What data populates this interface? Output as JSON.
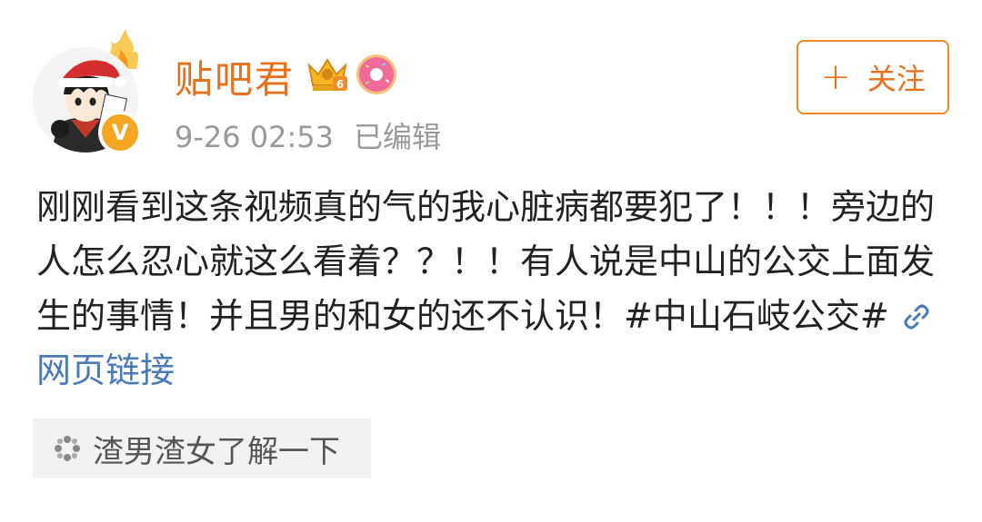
{
  "post": {
    "author": {
      "name": "贴吧君",
      "avatar_icon": "santa-hat-anime-avatar",
      "verified_icon": "verified-v-badge",
      "verified_label": "V",
      "badges": [
        "crown-vip-icon",
        "donut-icon"
      ],
      "crown_level": "6"
    },
    "timestamp": "9-26 02:53",
    "edited_label": "已编辑",
    "follow_button": {
      "plus": "+",
      "label": "关注"
    },
    "text": "刚刚看到这条视频真的气的我心脏病都要犯了！！！旁边的人怎么忍心就这么看着？？！！有人说是中山的公交上面发生的事情！并且男的和女的还不认识！#中山石岐公交#",
    "link": {
      "icon": "link-icon",
      "label": "网页链接"
    },
    "topic": {
      "icon": "topic-icon",
      "label": "渣男渣女了解一下"
    }
  },
  "colors": {
    "accent": "#e8701a",
    "link": "#4a7bb7",
    "meta": "#999999",
    "chip_bg": "#f2f2f2"
  }
}
